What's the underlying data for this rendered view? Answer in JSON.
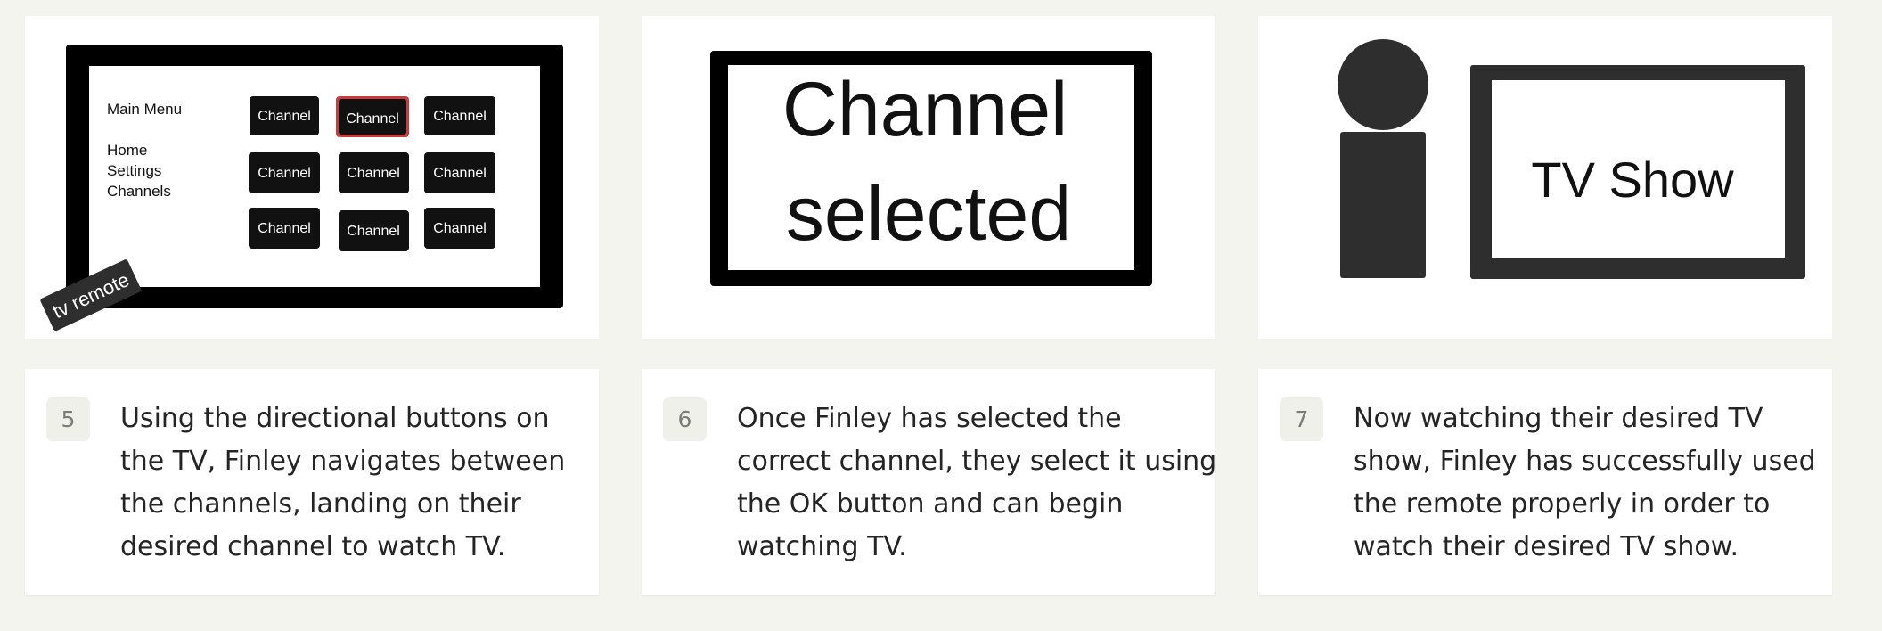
{
  "storyboard": {
    "panels": [
      {
        "scene": "tv-menu",
        "menu_title": "Main Menu",
        "menu_items": [
          "Home",
          "Settings",
          "Channels"
        ],
        "channel_buttons": [
          "Channel",
          "Channel",
          "Channel",
          "Channel",
          "Channel",
          "Channel",
          "Channel",
          "Channel",
          "Channel"
        ],
        "selected_channel_index": 1,
        "sticker_label": "tv remote"
      },
      {
        "scene": "channel-selected",
        "screen_text_line1": "Channel",
        "screen_text_line2": "selected"
      },
      {
        "scene": "watching-tv",
        "screen_text": "TV Show"
      }
    ],
    "steps": [
      {
        "number": "5",
        "text": "Using the directional buttons on the TV, Finley navigates between the channels, landing on their desired channel to watch TV."
      },
      {
        "number": "6",
        "text": "Once Finley has selected the correct channel, they select it using the OK button and can begin watching TV."
      },
      {
        "number": "7",
        "text": "Now watching their desired TV show, Finley has successfully used the remote properly in order to watch their desired TV show."
      }
    ],
    "colors": {
      "page_background": "#f4f4ef",
      "card_background": "#ffffff",
      "selection_outline": "#c83c3c",
      "dark_fill": "#2e2e2e"
    }
  }
}
